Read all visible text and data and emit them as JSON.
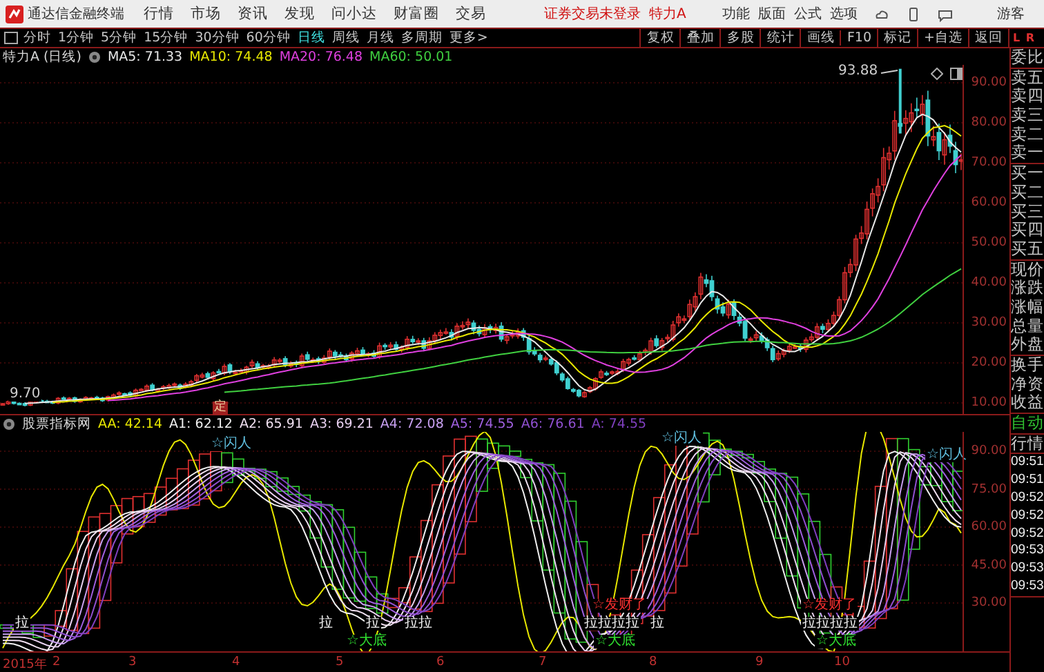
{
  "app": {
    "title": "通达信金融终端",
    "menu": [
      "行情",
      "市场",
      "资讯",
      "发现",
      "问小达",
      "财富圈",
      "交易"
    ],
    "status": "证券交易未登录",
    "stock": "特力A",
    "actions": [
      "功能",
      "版面",
      "公式",
      "选项"
    ],
    "user": "游客"
  },
  "periods": [
    {
      "label": "分时",
      "selected": false
    },
    {
      "label": "1分钟",
      "selected": false
    },
    {
      "label": "5分钟",
      "selected": false
    },
    {
      "label": "15分钟",
      "selected": false
    },
    {
      "label": "30分钟",
      "selected": false
    },
    {
      "label": "60分钟",
      "selected": false
    },
    {
      "label": "日线",
      "selected": true
    },
    {
      "label": "周线",
      "selected": false
    },
    {
      "label": "月线",
      "selected": false
    },
    {
      "label": "多周期",
      "selected": false
    },
    {
      "label": "更多>",
      "selected": false
    }
  ],
  "tools": [
    "复权",
    "叠加",
    "多股",
    "统计",
    "画线",
    "F10",
    "标记",
    "+自选",
    "返回"
  ],
  "panel_tabs": [
    "L",
    "R"
  ],
  "chart": {
    "title": "特力A (日线)",
    "ma": [
      {
        "label": "MA5: 71.33",
        "color": "#e8e8e8"
      },
      {
        "label": "MA10: 74.48",
        "color": "#e8e800"
      },
      {
        "label": "MA20: 76.48",
        "color": "#e040e0"
      },
      {
        "label": "MA60: 50.01",
        "color": "#40d040"
      }
    ],
    "yticks": [
      "90.00",
      "80.00",
      "70.00",
      "60.00",
      "50.00",
      "40.00",
      "30.00",
      "20.00",
      "10.00"
    ],
    "high_label": "93.88",
    "low_label": "9.70",
    "marker": "定"
  },
  "indicator": {
    "title": "股票指标网",
    "values": [
      {
        "label": "AA: 42.14",
        "color": "#e8e800"
      },
      {
        "label": "A1: 62.12",
        "color": "#f0f0f0"
      },
      {
        "label": "A2: 65.91",
        "color": "#f0e0f0"
      },
      {
        "label": "A3: 69.21",
        "color": "#e8d0f0"
      },
      {
        "label": "A4: 72.08",
        "color": "#c8a0f0"
      },
      {
        "label": "A5: 74.55",
        "color": "#a060e0"
      },
      {
        "label": "A6: 76.61",
        "color": "#9050d0"
      },
      {
        "label": "A: 74.55",
        "color": "#8040c0"
      }
    ],
    "yticks": [
      "90.00",
      "75.00",
      "60.00",
      "45.00",
      "30.00"
    ],
    "annotations": [
      {
        "kind": "exit",
        "text": "☆闪人"
      },
      {
        "kind": "exit",
        "text": "☆闪人"
      },
      {
        "kind": "exit",
        "text": "☆闪人"
      },
      {
        "kind": "pull",
        "text": "拉"
      },
      {
        "kind": "pull",
        "text": "拉"
      },
      {
        "kind": "pull",
        "text": "拉"
      },
      {
        "kind": "pull",
        "text": "拉拉"
      },
      {
        "kind": "pull",
        "text": "拉拉拉拉"
      },
      {
        "kind": "pull",
        "text": "拉"
      },
      {
        "kind": "pull",
        "text": "拉拉拉拉"
      },
      {
        "kind": "profit",
        "text": "☆发财了"
      },
      {
        "kind": "profit",
        "text": "☆发财了"
      },
      {
        "kind": "bottom",
        "text": "☆大底"
      },
      {
        "kind": "bottom",
        "text": "☆大底"
      },
      {
        "kind": "bottom",
        "text": "☆大底"
      }
    ]
  },
  "xaxis": [
    "2015年",
    "2",
    "3",
    "4",
    "5",
    "6",
    "7",
    "8",
    "9",
    "10"
  ],
  "side_panel": {
    "groups": [
      [
        {
          "kind": "label",
          "text": "委比"
        }
      ],
      [
        {
          "kind": "label",
          "text": "卖五"
        },
        {
          "kind": "label",
          "text": "卖四"
        },
        {
          "kind": "label",
          "text": "卖三"
        },
        {
          "kind": "label",
          "text": "卖二"
        },
        {
          "kind": "label",
          "text": "卖一"
        }
      ],
      [
        {
          "kind": "label",
          "text": "买一"
        },
        {
          "kind": "label",
          "text": "买二"
        },
        {
          "kind": "label",
          "text": "买三"
        },
        {
          "kind": "label",
          "text": "买四"
        },
        {
          "kind": "label",
          "text": "买五"
        }
      ],
      [
        {
          "kind": "label",
          "text": "现价"
        },
        {
          "kind": "label",
          "text": "涨跌"
        },
        {
          "kind": "label",
          "text": "涨幅"
        },
        {
          "kind": "label",
          "text": "总量"
        },
        {
          "kind": "label",
          "text": "外盘"
        }
      ],
      [
        {
          "kind": "label",
          "text": "换手"
        },
        {
          "kind": "label",
          "text": "净资"
        },
        {
          "kind": "label",
          "text": "收益"
        }
      ],
      [
        {
          "kind": "mode",
          "text": "自动"
        }
      ],
      [
        {
          "kind": "label",
          "text": "行情"
        }
      ],
      [
        {
          "kind": "time",
          "text": "09:51"
        },
        {
          "kind": "time",
          "text": "09:51"
        },
        {
          "kind": "time",
          "text": "09:52"
        },
        {
          "kind": "time",
          "text": "09:52"
        },
        {
          "kind": "time",
          "text": "09:52"
        },
        {
          "kind": "time",
          "text": "09:53"
        },
        {
          "kind": "time",
          "text": "09:53"
        },
        {
          "kind": "time",
          "text": "09:53"
        }
      ]
    ]
  }
}
